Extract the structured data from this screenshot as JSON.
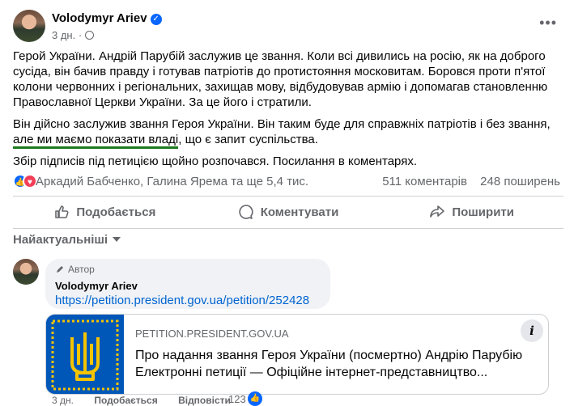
{
  "post": {
    "author": "Volodymyr Ariev",
    "time": "3 дн.",
    "paragraphs": {
      "p1": "Герой України. Андрій Парубій заслужив це звання. Коли всі дивились на росію, як на доброго сусіда, він бачив правду і готував патріотів до протистояння московитам. Боровся проти п'ятої колони червонних і регіональних, захищав мову, відбудовував армію і допомагав становленню Православної Церкви України. За це його і стратили.",
      "p2_before": "Він дійсно заслужив звання Героя України. Він таким буде для справжніх патріотів і без звання, ",
      "p2_underlined": "але ми маємо показати владі",
      "p2_after": ", що є запит суспільства.",
      "p3": "Збір підписів під петицією щойно розпочався. Посилання в коментарях."
    },
    "reactions_names": "Аркадий Бабченко, Галина Ярема та ще 5,4 тис.",
    "comments_count": "511 коментарів",
    "shares_count": "248 поширень",
    "accent_color": "#0866ff",
    "underline_color": "#1e7a1e"
  },
  "actions": {
    "like": "Подобається",
    "comment": "Коментувати",
    "share": "Поширити"
  },
  "sort": {
    "label": "Найактуальніші"
  },
  "comment": {
    "badge": "Автор",
    "author": "Volodymyr Ariev",
    "link": "https://petition.president.gov.ua/petition/252428",
    "card": {
      "domain": "PETITION.PRESIDENT.GOV.UA",
      "title": "Про надання звання Героя України (посмертно) Андрію Парубію Електронні петиції — Офіційне інтернет-представництво..."
    },
    "info_label": "i",
    "footer": {
      "time": "3 дн.",
      "like": "Подобається",
      "reply": "Відповісти",
      "reactions": "123"
    }
  }
}
